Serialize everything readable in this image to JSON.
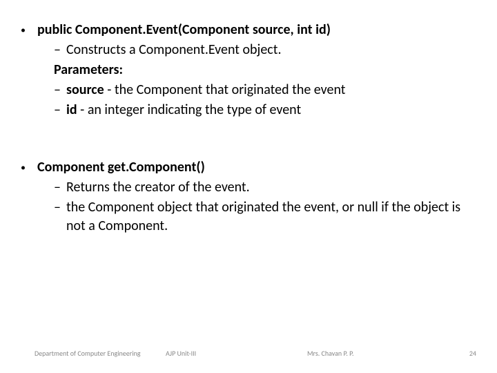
{
  "section1": {
    "title": "public Component.Event(Component  source, int id)",
    "line1": "Constructs a Component.Event object.",
    "params_label": "Parameters:",
    "param1_name": "source",
    "param1_desc": " - the Component that originated the event",
    "param2_name": "id",
    "param2_desc": " - an integer indicating the type of event"
  },
  "section2": {
    "title": "Component  get.Component()",
    "line1": "Returns the creator of the event.",
    "line2": "the Component object that originated the event, or null if the object is not a Component."
  },
  "footer": {
    "dept": "Department of Computer Engineering",
    "unit": "AJP Unit-III",
    "author": "Mrs. Chavan P. P.",
    "page": "24"
  }
}
